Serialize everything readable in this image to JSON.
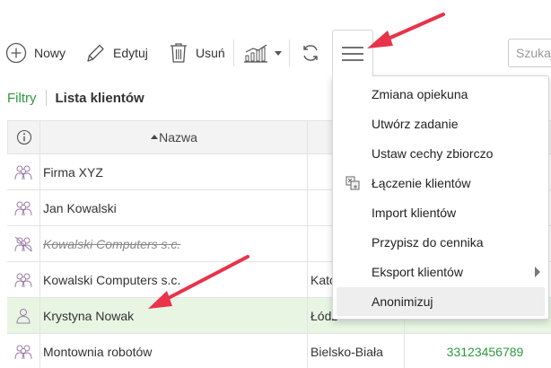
{
  "toolbar": {
    "new_label": "Nowy",
    "edit_label": "Edytuj",
    "delete_label": "Usuń",
    "search_placeholder": "Szukaj"
  },
  "breadcrumb": {
    "filters": "Filtry",
    "title": "Lista klientów"
  },
  "table": {
    "header": {
      "name": "Nazwa"
    },
    "rows": [
      {
        "name": "Firma XYZ",
        "city": "",
        "phone": ""
      },
      {
        "name": "Jan Kowalski",
        "city": "",
        "phone": ""
      },
      {
        "name": "Kowalski Computers s.c.",
        "city": "",
        "phone": ""
      },
      {
        "name": "Kowalski Computers s.c.",
        "city": "Kato",
        "phone": ""
      },
      {
        "name": "Krystyna Nowak",
        "city": "Łódź",
        "phone": ""
      },
      {
        "name": "Montownia robotów",
        "city": "Bielsko-Biała",
        "phone": "33123456789"
      }
    ]
  },
  "menu": {
    "items": [
      {
        "label": "Zmiana opiekuna"
      },
      {
        "label": "Utwórz zadanie"
      },
      {
        "label": "Ustaw cechy zbiorczo"
      },
      {
        "label": "Łączenie klientów"
      },
      {
        "label": "Import klientów"
      },
      {
        "label": "Przypisz do cennika"
      },
      {
        "label": "Eksport klientów"
      },
      {
        "label": "Anonimizuj"
      }
    ]
  },
  "colors": {
    "accent_green": "#2e9a3e",
    "annotation_red": "#e8334a",
    "selected_row": "#e8f5e3"
  }
}
